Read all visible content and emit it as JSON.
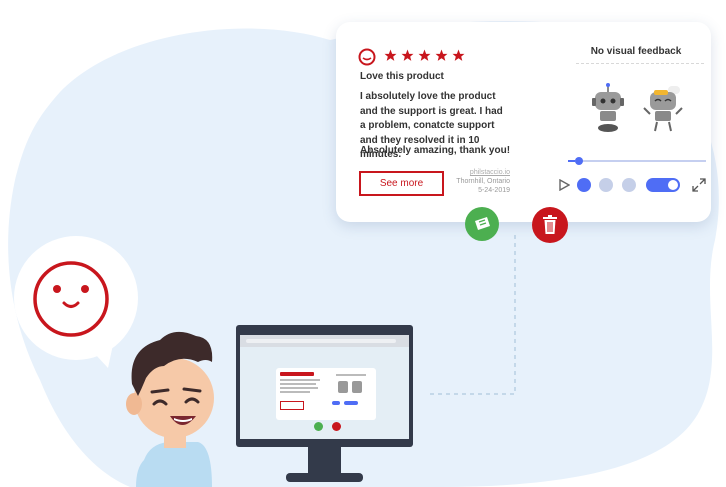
{
  "review": {
    "rating": 5,
    "title": "Love this product",
    "body": "I absolutely love the product and the support is great. I had a problem, conatcte support and they resolved it in 10 minutes.",
    "closing": "Absolutely amazing, thank you!",
    "see_more_label": "See more",
    "site": "philstaccio.io",
    "location": "Thornhill, Ontario",
    "date": "5-24-2019"
  },
  "feedback_panel": {
    "title": "No visual feedback",
    "slider_value": 0.05,
    "toggle_on": true
  },
  "actions": {
    "approve_icon": "ticket-icon",
    "delete_icon": "trash-icon"
  },
  "colors": {
    "accent_red": "#c8161d",
    "accent_blue": "#4f6df5",
    "approve_green": "#4caf50",
    "background_blob": "#e7f1fb"
  }
}
